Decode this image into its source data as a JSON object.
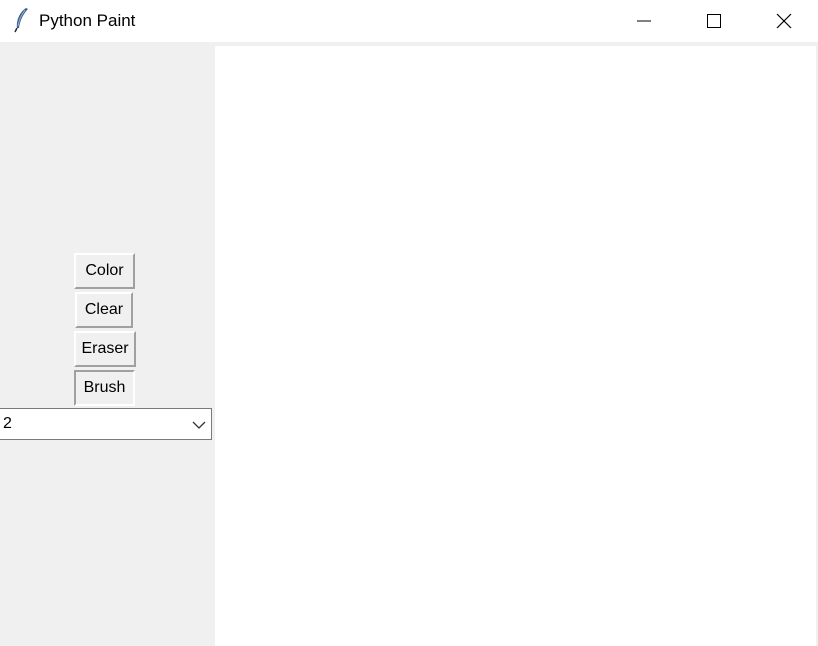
{
  "window": {
    "title": "Python Paint"
  },
  "titlebar_buttons": {
    "minimize_icon": "minimize-icon",
    "maximize_icon": "maximize-icon",
    "close_icon": "close-icon"
  },
  "tools": {
    "color_label": "Color",
    "clear_label": "Clear",
    "eraser_label": "Eraser",
    "brush_label": "Brush",
    "active_tool": "Brush"
  },
  "brush_size": {
    "selected": "2"
  },
  "colors": {
    "panel_bg": "#f0f0f0",
    "canvas_bg": "#ffffff"
  }
}
